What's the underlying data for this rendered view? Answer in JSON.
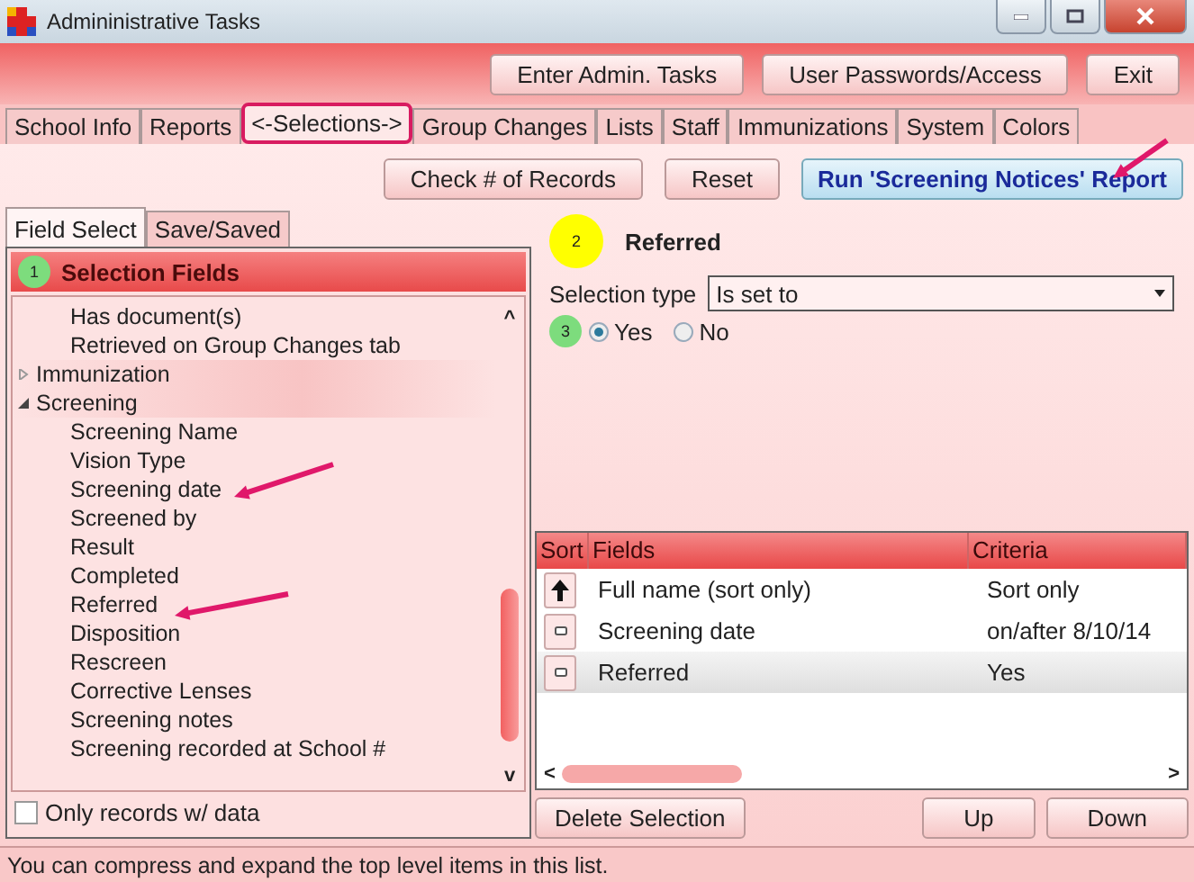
{
  "window": {
    "title": "Admininistrative Tasks"
  },
  "top_buttons": [
    "Enter Admin. Tasks",
    "User Passwords/Access",
    "Exit"
  ],
  "tabs": [
    {
      "label": "School Info",
      "selected": false
    },
    {
      "label": "Reports",
      "selected": false
    },
    {
      "label": "<-Selections->",
      "selected": true
    },
    {
      "label": "Group Changes",
      "selected": false
    },
    {
      "label": "Lists",
      "selected": false
    },
    {
      "label": "Staff",
      "selected": false
    },
    {
      "label": "Immunizations",
      "selected": false
    },
    {
      "label": "System",
      "selected": false
    },
    {
      "label": "Colors",
      "selected": false
    }
  ],
  "action_buttons": [
    {
      "label": "Check # of Records",
      "kind": "plain"
    },
    {
      "label": "Reset",
      "kind": "plain"
    },
    {
      "label": "Run 'Screening Notices' Report",
      "kind": "primary"
    }
  ],
  "panel_tabs": [
    {
      "label": "Field Select",
      "selected": true
    },
    {
      "label": "Save/Saved",
      "selected": false
    }
  ],
  "field_list": {
    "header": "Selection Fields",
    "step": "1",
    "continued_items": [
      "Has document(s)",
      "Retrieved on Group Changes tab"
    ],
    "groups": [
      {
        "label": "Immunization",
        "expanded": false
      },
      {
        "label": "Screening",
        "expanded": true,
        "children": [
          "Screening Name",
          "Vision Type",
          "Screening date",
          "Screened by",
          "Result",
          "Completed",
          "Referred",
          "Disposition",
          "Rescreen",
          "Corrective Lenses",
          "Screening notes",
          "Screening recorded at School #"
        ]
      }
    ],
    "scroll_up": "^",
    "scroll_down": "v"
  },
  "only_with_data": {
    "label": "Only records w/ data",
    "checked": false
  },
  "detail": {
    "step": "2",
    "field": "Referred",
    "selection_type_label": "Selection type",
    "selection_type": "Is set to",
    "value_step": "3",
    "options": [
      {
        "label": "Yes",
        "selected": true
      },
      {
        "label": "No",
        "selected": false
      }
    ]
  },
  "criteria_table": {
    "columns": [
      "Sort",
      "Fields",
      "Criteria"
    ],
    "rows": [
      {
        "sort_ascending": true,
        "field": "Full name (sort only)",
        "criteria": "Sort only",
        "selected": false
      },
      {
        "sort_ascending": false,
        "field": "Screening date",
        "criteria": "on/after 8/10/14",
        "selected": false
      },
      {
        "sort_ascending": false,
        "field": "Referred",
        "criteria": "Yes",
        "selected": true
      }
    ],
    "scroll_left": "<",
    "scroll_right": ">"
  },
  "bottom_buttons": [
    "Delete Selection",
    "Up",
    "Down"
  ],
  "status_bar": "You can compress and expand the top level items in this list."
}
